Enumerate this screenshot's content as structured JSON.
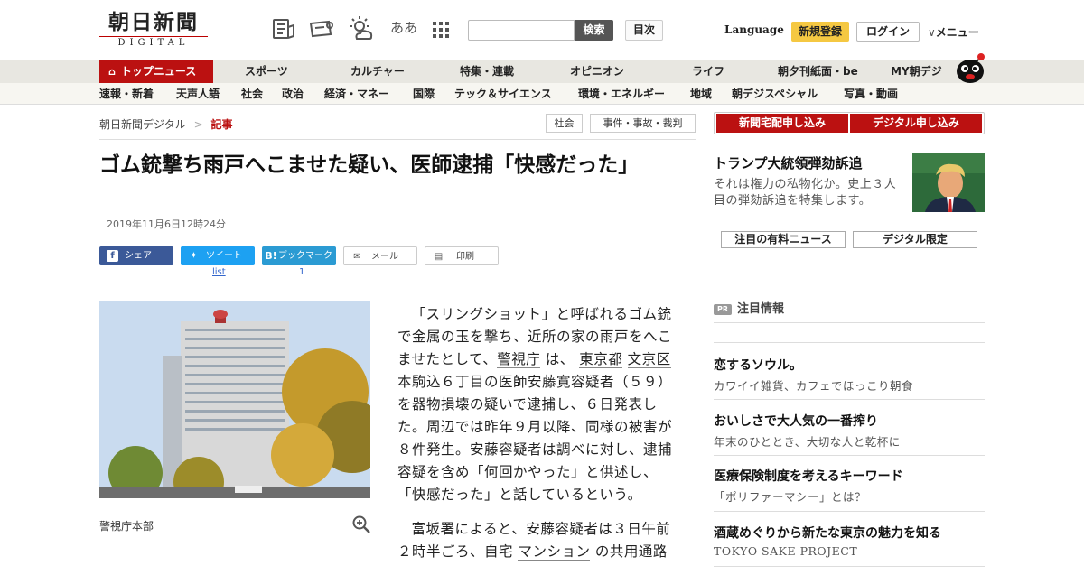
{
  "header": {
    "logo_main": "朝日新聞",
    "logo_sub": "DIGITAL",
    "font_size_toggle": "ああ",
    "search_placeholder": "",
    "search_button": "検索",
    "toc_button": "目次",
    "language": "Language",
    "register": "新規登録",
    "login": "ログイン",
    "menu": "メニュー"
  },
  "nav_main": [
    "トップニュース",
    "スポーツ",
    "カルチャー",
    "特集・連載",
    "オピニオン",
    "ライフ",
    "朝夕刊紙面・be",
    "MY朝デジ"
  ],
  "nav_sub": [
    "速報・新着",
    "天声人語",
    "社会",
    "政治",
    "経済・マネー",
    "国際",
    "テック＆サイエンス",
    "環境・エネルギー",
    "地域",
    "朝デジスペシャル",
    "写真・動画"
  ],
  "breadcrumb": {
    "home": "朝日新聞デジタル",
    "sep": ">",
    "current": "記事"
  },
  "tags": [
    "社会",
    "事件・事故・裁判"
  ],
  "article": {
    "title": "ゴム銃撃ち雨戸へこませた疑い、医師逮捕「快感だった」",
    "date": "2019年11月6日12時24分",
    "share": {
      "facebook": "シェア",
      "twitter": "ツイート",
      "twitter_count": "list",
      "hatena": "ブックマーク",
      "hatena_count": "1",
      "mail": "メール",
      "print": "印刷"
    },
    "caption": "警視庁本部",
    "p1_a": "「スリングショット」と呼ばれるゴム銃で金属の玉を撃ち、近所の家の雨戸をへこませたとして、",
    "link1": "警視庁",
    "p1_b": "は、",
    "link2": "東京都",
    "link3": "文京区",
    "p1_c": "本駒込６丁目の医師安藤寛容疑者（５９）を器物損壊の疑いで逮捕し、６日発表した。周辺では昨年９月以降、同様の被害が８件発生。安藤容疑者は調べに対し、逮捕容疑を含め「何回かやった」と供述し、「快感だった」と話しているという。",
    "p2_a": "富坂署によると、安藤容疑者は３日午前２時半ごろ、自宅",
    "link4": "マンション",
    "p2_b": "の共用通路"
  },
  "sidebar": {
    "subscribe_paper": "新聞宅配申し込み",
    "subscribe_digital": "デジタル申し込み",
    "feature_title": "トランプ大統領弾劾訴追",
    "feature_text": "それは権力の私物化か。史上３人目の弾劾訴追を特集します。",
    "btn_paid": "注目の有料ニュース",
    "btn_digital": "デジタル限定",
    "pr_badge": "PR",
    "pr_heading": "注目情報",
    "pr_items": [
      {
        "title": "恋するソウル。",
        "desc": "カワイイ雑貨、カフェでほっこり朝食"
      },
      {
        "title": "おいしさで大人気の一番搾り",
        "desc": "年末のひととき、大切な人と乾杯に"
      },
      {
        "title": "医療保険制度を考えるキーワード",
        "desc": "「ポリファーマシー」とは？"
      },
      {
        "title": "酒蔵めぐりから新たな東京の魅力を知る",
        "desc": "TOKYO SAKE PROJECT"
      }
    ]
  },
  "colors": {
    "brand_red": "#b11111",
    "nav_bg": "#e8e7e1",
    "register_yellow": "#f5c842",
    "facebook": "#3b5998",
    "twitter": "#1da1f2",
    "hatena": "#2b9bd3"
  }
}
